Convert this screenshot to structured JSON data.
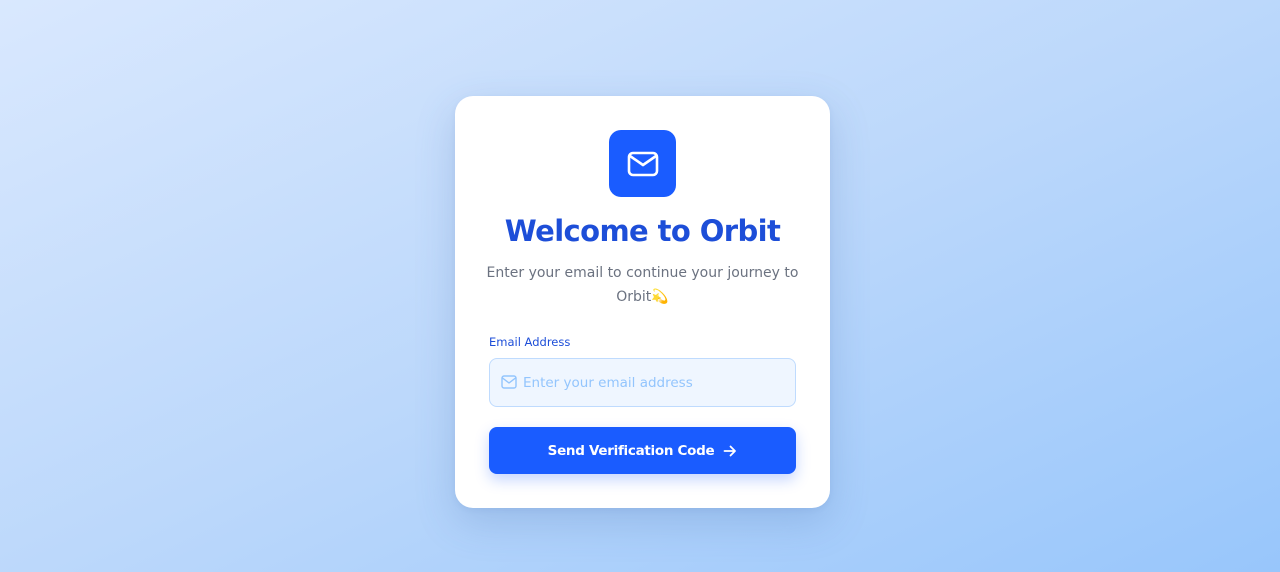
{
  "card": {
    "logo_icon": "mail-icon",
    "title": "Welcome to Orbit",
    "subtitle": "Enter your email to continue your journey to Orbit💫"
  },
  "form": {
    "email_label": "Email Address",
    "email_placeholder": "Enter your email address",
    "email_value": "",
    "input_icon": "mail-icon",
    "submit_label": "Send Verification Code",
    "submit_icon": "arrow-right-icon"
  },
  "colors": {
    "primary": "#1a5cff",
    "title": "#1d4ed8",
    "input_background": "#eff6ff",
    "placeholder": "#93c5fd"
  }
}
